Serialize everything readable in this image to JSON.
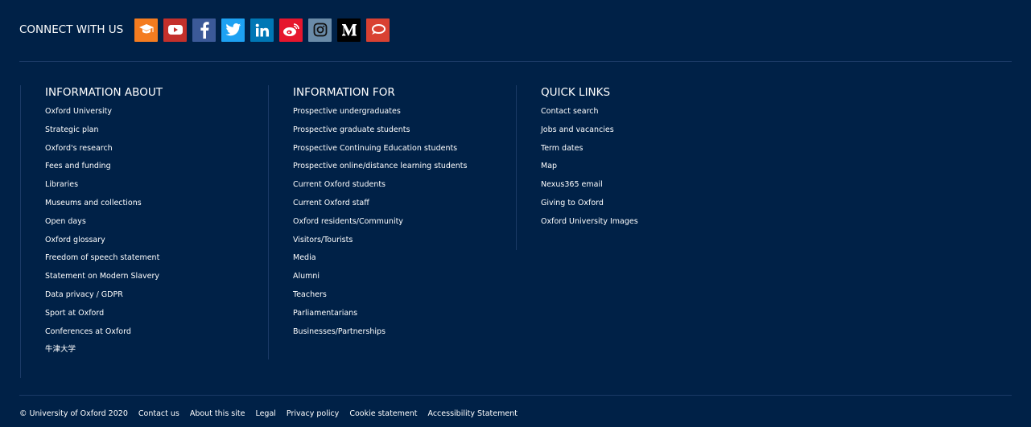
{
  "connect": {
    "label": "CONNECT WITH US",
    "icons": [
      {
        "name": "mortarboard-icon",
        "color": "#f47c20"
      },
      {
        "name": "youtube-icon",
        "color": "#c4302b"
      },
      {
        "name": "facebook-icon",
        "color": "#3b5998"
      },
      {
        "name": "twitter-icon",
        "color": "#1da1f2"
      },
      {
        "name": "linkedin-icon",
        "color": "#0077b5"
      },
      {
        "name": "weibo-icon",
        "color": "#e6162d"
      },
      {
        "name": "instagram-icon",
        "color": "#6a8ba8"
      },
      {
        "name": "medium-icon",
        "color": "#000000"
      },
      {
        "name": "chat-bubble-icon",
        "color": "#d94132"
      }
    ]
  },
  "columns": {
    "about": {
      "heading": "INFORMATION ABOUT",
      "links": [
        "Oxford University",
        "Strategic plan",
        "Oxford's research",
        "Fees and funding",
        "Libraries",
        "Museums and collections",
        "Open days",
        "Oxford glossary",
        "Freedom of speech statement",
        "Statement on Modern Slavery",
        "Data privacy / GDPR",
        "Sport at Oxford",
        "Conferences at Oxford",
        "牛津大学"
      ]
    },
    "for": {
      "heading": "INFORMATION FOR",
      "links": [
        "Prospective undergraduates",
        "Prospective graduate students",
        "Prospective Continuing Education students",
        "Prospective online/distance learning students",
        "Current Oxford students",
        "Current Oxford staff",
        "Oxford residents/Community",
        "Visitors/Tourists",
        "Media",
        "Alumni",
        "Teachers",
        "Parliamentarians",
        "Businesses/Partnerships"
      ]
    },
    "quick": {
      "heading": "QUICK LINKS",
      "links": [
        "Contact search",
        "Jobs and vacancies",
        "Term dates",
        "Map",
        "Nexus365 email",
        "Giving to Oxford",
        "Oxford University Images"
      ]
    }
  },
  "footer": {
    "copyright": "© University of Oxford 2020",
    "links": [
      "Contact us",
      "About this site",
      "Legal",
      "Privacy policy",
      "Cookie statement",
      "Accessibility Statement"
    ]
  },
  "colors": {
    "background": "#002147",
    "divider": "#1b3a66",
    "text": "#ffffff"
  }
}
